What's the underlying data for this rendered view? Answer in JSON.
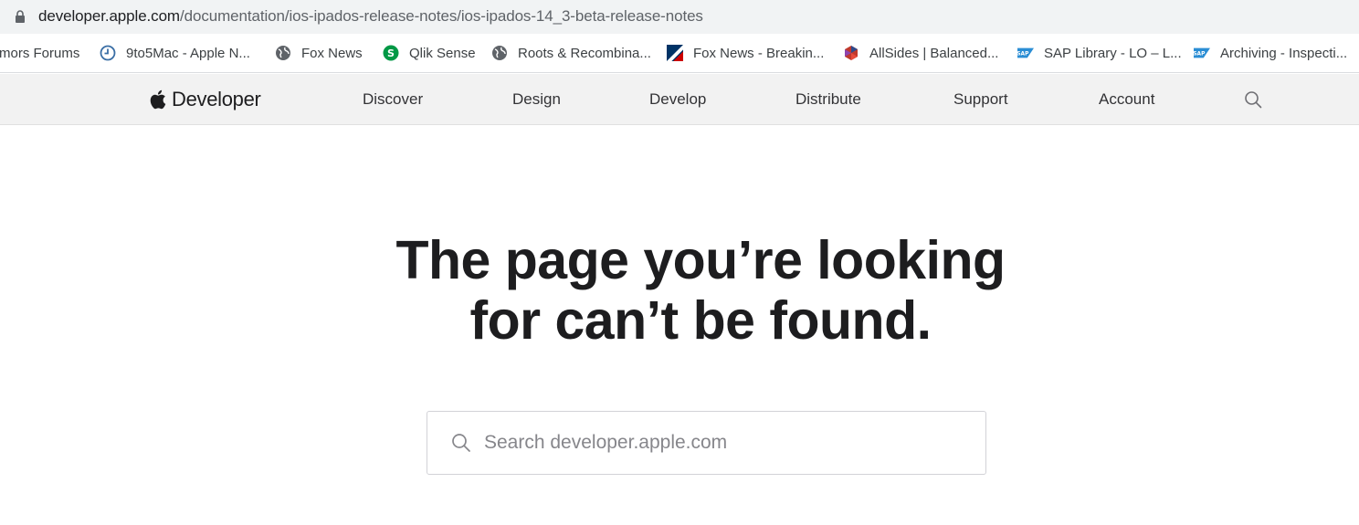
{
  "address_bar": {
    "url_host": "developer.apple.com",
    "url_path": "/documentation/ios-ipados-release-notes/ios-ipados-14_3-beta-release-notes"
  },
  "bookmarks": [
    {
      "label": "mors Forums",
      "icon": "none"
    },
    {
      "label": "9to5Mac - Apple N...",
      "icon": "clock-icon"
    },
    {
      "label": "Fox News",
      "icon": "globe-icon"
    },
    {
      "label": "Qlik Sense",
      "icon": "qlik-icon"
    },
    {
      "label": "Roots & Recombina...",
      "icon": "globe-icon"
    },
    {
      "label": "Fox News - Breakin...",
      "icon": "foxnews-icon"
    },
    {
      "label": "AllSides | Balanced...",
      "icon": "allsides-icon"
    },
    {
      "label": "SAP Library - LO – L...",
      "icon": "sap-icon"
    },
    {
      "label": "Archiving - Inspecti...",
      "icon": "sap-icon"
    }
  ],
  "nav": {
    "brand": "Developer",
    "items": [
      "Discover",
      "Design",
      "Develop",
      "Distribute",
      "Support",
      "Account"
    ]
  },
  "main": {
    "headline_line1": "The page you’re looking",
    "headline_line2": "for can’t be found.",
    "search_placeholder": "Search developer.apple.com"
  },
  "colors": {
    "nav_background": "#f2f2f2",
    "headline": "#1d1d1f",
    "address_bar_background": "#f1f3f4"
  }
}
